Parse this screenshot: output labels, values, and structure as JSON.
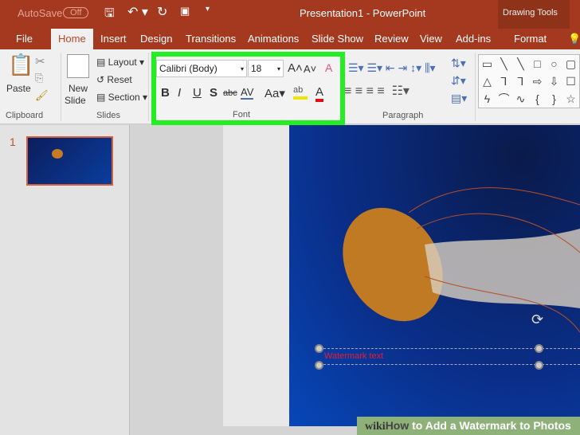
{
  "titlebar": {
    "autosave": "AutoSave",
    "toggle": "Off",
    "title": "Presentation1  -  PowerPoint",
    "context": "Drawing Tools"
  },
  "tabs": [
    "File",
    "Home",
    "Insert",
    "Design",
    "Transitions",
    "Animations",
    "Slide Show",
    "Review",
    "View",
    "Add-ins",
    "Format"
  ],
  "ribbon": {
    "clipboard": {
      "paste": "Paste",
      "label": "Clipboard"
    },
    "slides": {
      "new": "New",
      "slide": "Slide",
      "layout": "Layout",
      "reset": "Reset",
      "section": "Section",
      "label": "Slides"
    },
    "font": {
      "family": "Calibri (Body)",
      "size": "18",
      "bold": "B",
      "italic": "I",
      "underline": "U",
      "shadow": "S",
      "strike": "abc",
      "spacing": "AV",
      "case": "Aa",
      "color": "A",
      "grow": "A",
      "shrink": "A",
      "label": "Font"
    },
    "paragraph": {
      "label": "Paragraph"
    },
    "shapes": [
      "▭",
      "╲",
      "╲",
      "□",
      "○",
      "▢",
      "△",
      "⅂",
      "⅂",
      "⇨",
      "⇩",
      "☐",
      "ϟ",
      "⌒",
      "∿",
      "{",
      "}",
      "☆"
    ]
  },
  "thumbnail": {
    "number": "1"
  },
  "slide": {
    "textbox": "Watermark text"
  },
  "watermark": {
    "wiki": "wiki",
    "how": "How",
    "rest": " to Add a Watermark to Photos"
  },
  "colors": {
    "brand": "#a5391f",
    "highlight": "#22ee22"
  }
}
